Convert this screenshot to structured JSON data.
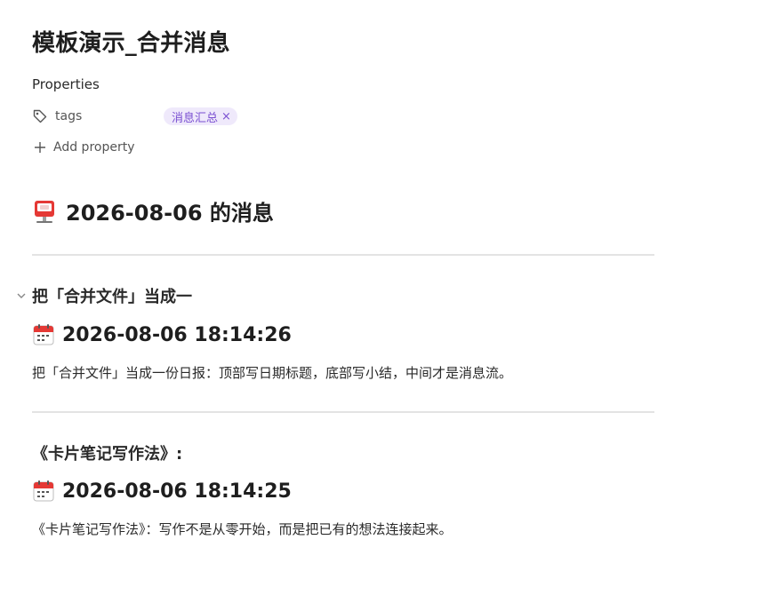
{
  "page": {
    "title": "模板演示_合并消息",
    "properties_heading": "Properties",
    "property": {
      "key": "tags",
      "tag": "消息汇总",
      "remove_glyph": "×"
    },
    "add_property_label": "Add property"
  },
  "heading": {
    "icon": "mailbox-icon",
    "text": "2026-08-06 的消息"
  },
  "entries": [
    {
      "title": "把「合并文件」当成一",
      "datetime": "2026-08-06 18:14:26",
      "icon": "calendar-icon",
      "body": "把「合并文件」当成一份日报：顶部写日期标题，底部写小结，中间才是消息流。"
    },
    {
      "title": "《卡片笔记写作法》:",
      "datetime": "2026-08-06 18:14:25",
      "icon": "calendar-icon",
      "body": "《卡片笔记写作法》：写作不是从零开始，而是把已有的想法连接起来。"
    }
  ],
  "colors": {
    "tag_bg": "#efe9fb",
    "tag_text": "#7a4fd1",
    "divider": "#e3e3e3"
  }
}
